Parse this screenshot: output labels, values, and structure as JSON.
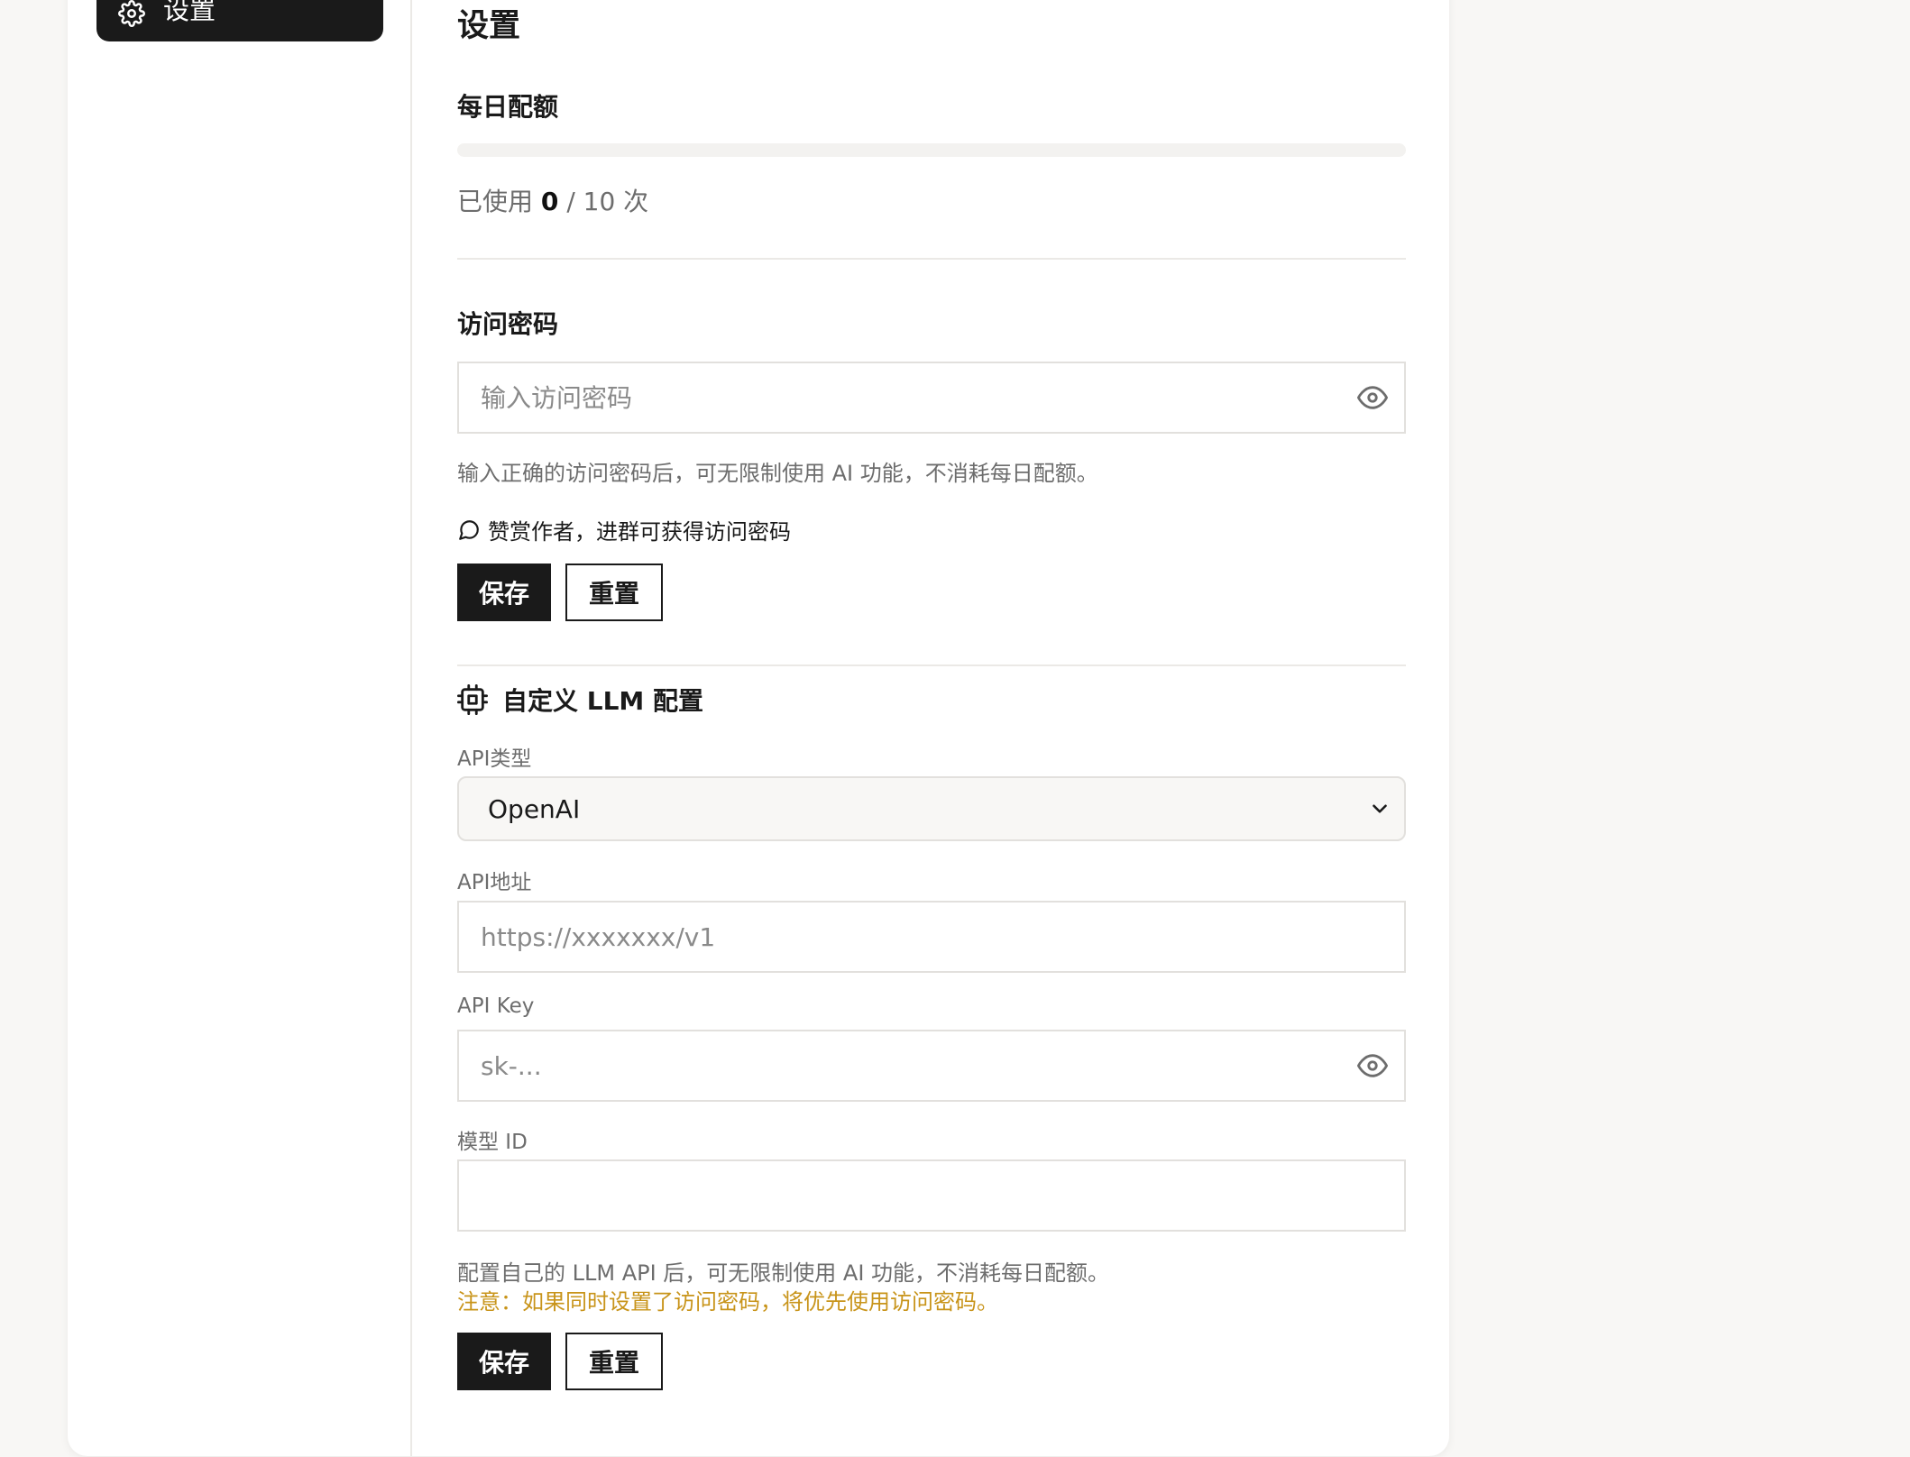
{
  "sidebar": {
    "items": [
      {
        "label": "设置",
        "icon": "gear-icon",
        "active": true
      }
    ]
  },
  "page": {
    "title": "设置"
  },
  "quota": {
    "title": "每日配额",
    "used_prefix": "已使用",
    "used": "0",
    "total_suffix": "/ 10 次",
    "used_count": 0,
    "limit": 10
  },
  "access": {
    "title": "访问密码",
    "placeholder": "输入访问密码",
    "hint": "输入正确的访问密码后，可无限制使用 AI 功能，不消耗每日配额。",
    "link_label": "赞赏作者，进群可获得访问密码",
    "save_label": "保存",
    "reset_label": "重置"
  },
  "llm": {
    "title": "自定义 LLM 配置",
    "api_type_label": "API类型",
    "api_type_value": "OpenAI",
    "api_url_label": "API地址",
    "api_url_placeholder": "https://xxxxxxx/v1",
    "api_key_label": "API Key",
    "api_key_placeholder": "sk-...",
    "model_id_label": "模型 ID",
    "model_id_value": "",
    "hint": "配置自己的 LLM API 后，可无限制使用 AI 功能，不消耗每日配额。",
    "warning": "注意：如果同时设置了访问密码，将优先使用访问密码。",
    "save_label": "保存",
    "reset_label": "重置"
  },
  "colors": {
    "accent": "#1a1a1a",
    "warning": "#c8941a",
    "background": "#f8f7f5"
  }
}
